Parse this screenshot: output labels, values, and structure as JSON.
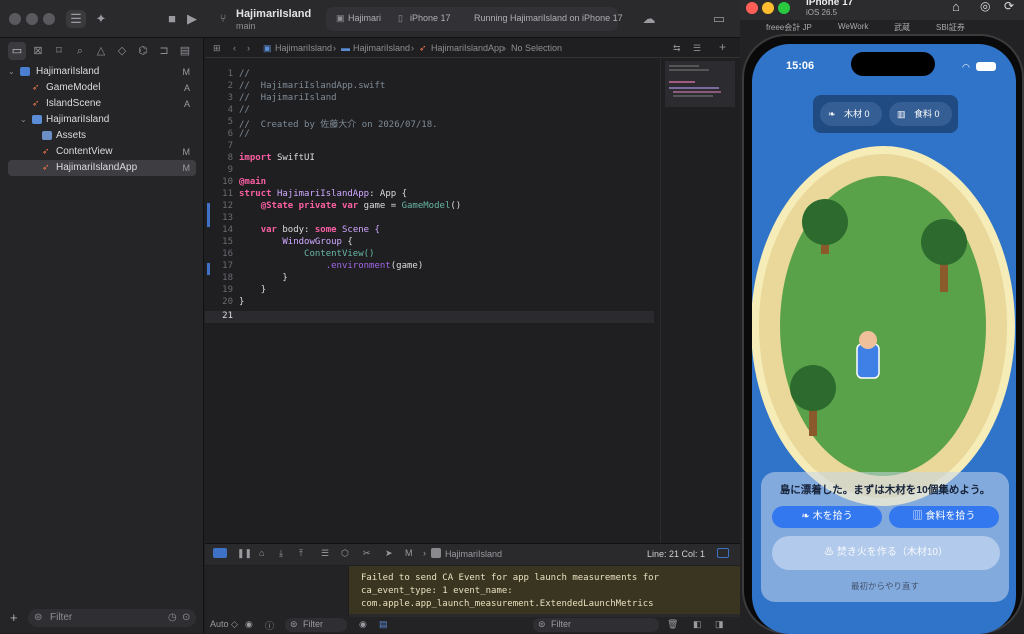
{
  "toolbar": {
    "project_name": "HajimariIsland",
    "branch": "main",
    "scheme_target": "Hajimari",
    "device": "iPhone 17",
    "status": "Running HajimariIsland on iPhone 17"
  },
  "jumpbar": {
    "crumbs": [
      "HajimariIsland",
      "HajimariIsland",
      "HajimariIslandApp",
      "No Selection"
    ]
  },
  "navigator": {
    "items": [
      {
        "label": "HajimariIsland",
        "status": "M"
      },
      {
        "label": "GameModel",
        "status": "A"
      },
      {
        "label": "IslandScene",
        "status": "A"
      },
      {
        "label": "HajimariIsland",
        "status": ""
      },
      {
        "label": "Assets",
        "status": ""
      },
      {
        "label": "ContentView",
        "status": "M"
      },
      {
        "label": "HajimariIslandApp",
        "status": "M"
      }
    ],
    "filter_placeholder": "Filter"
  },
  "editor": {
    "line_numbers": [
      "1",
      "2",
      "3",
      "4",
      "5",
      "6",
      "7",
      "8",
      "9",
      "10",
      "11",
      "12",
      "13",
      "14",
      "15",
      "16",
      "17",
      "18",
      "19",
      "20",
      "21"
    ],
    "comments": {
      "l1": "//",
      "l2": "//  HajimariIslandApp.swift",
      "l3": "//  HajimariIsland",
      "l4": "//",
      "l5": "//  Created by 佐藤大介 on 2026/07/18.",
      "l6": "//"
    },
    "tokens": {
      "import": "import",
      "swiftui": "SwiftUI",
      "main_attr": "@main",
      "struct": "struct",
      "app_name": "HajimariIslandApp",
      "colon_app": ": App {",
      "state_attr": "@State",
      "private_var": "private var",
      "game_eq": "game =",
      "game_model": "GameModel",
      "parens": "()",
      "var": "var",
      "body": "body:",
      "some": "some",
      "scene": "Scene {",
      "window_group": "WindowGroup",
      "open_brace": "{",
      "content_view": "ContentView()",
      "environment": ".environment",
      "env_arg": "(game)",
      "close_brace": "}"
    }
  },
  "debug": {
    "target": "HajimariIsland",
    "line_col": "Line: 21  Col: 1",
    "console_lines": [
      "Failed to send CA Event for app launch measurements for",
      "ca_event_type: 1 event_name:",
      "com.apple.app_launch_measurement.ExtendedLaunchMetrics"
    ],
    "auto_label": "Auto ◇",
    "filter_left": "Filter",
    "filter_right": "Filter"
  },
  "simulator": {
    "device_name": "iPhone 17",
    "ios_version": "iOS 26.5",
    "bookmarks": [
      "freee会計 JP",
      "WeWork",
      "武蔵",
      "SBI証券"
    ],
    "status_time": "15:06",
    "hud": {
      "wood": "木材 0",
      "food": "食料 0"
    },
    "message": "島に漂着した。まずは木材を10個集めよう。",
    "buttons": {
      "gather_wood": "木を拾う",
      "gather_food": "食料を拾う",
      "make_fire": "焚き火を作る（木材10）",
      "restart": "最初からやり直す"
    }
  },
  "colors": {
    "sea": "#2f74c9",
    "sand": "#e9d89a",
    "grass": "#5aa24a",
    "button": "#3478f0",
    "keyword": "#fc5fa3"
  }
}
